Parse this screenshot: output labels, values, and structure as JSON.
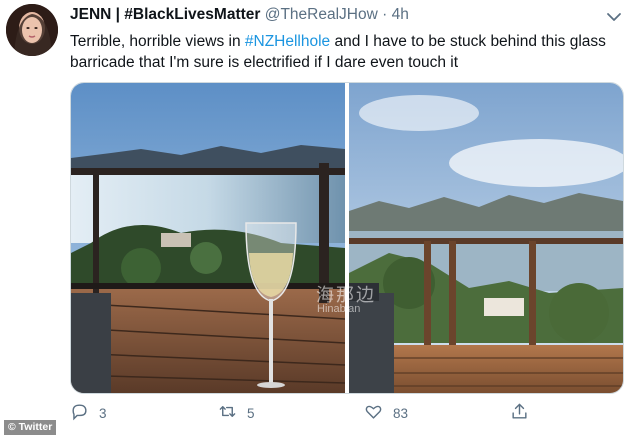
{
  "tweet": {
    "display_name": "JENN | #BlackLivesMatter",
    "handle": "@TheRealJHow",
    "separator": "·",
    "time": "4h",
    "text_part1": "Terrible, horrible views in ",
    "hashtag": "#NZHellhole",
    "text_part2": " and I have to be stuck behind this glass barricade that I'm sure is electrified if I dare even touch it"
  },
  "media": {
    "watermark": "海那边",
    "watermark_sub": "Hinabian"
  },
  "actions": {
    "reply_count": "3",
    "retweet_count": "5",
    "like_count": "83"
  },
  "credit": "© Twitter",
  "colors": {
    "link": "#1b95e0",
    "secondary_text": "#5b7083"
  },
  "icons": [
    "avatar",
    "chevron-down-icon",
    "reply-icon",
    "retweet-icon",
    "like-icon",
    "share-icon"
  ]
}
